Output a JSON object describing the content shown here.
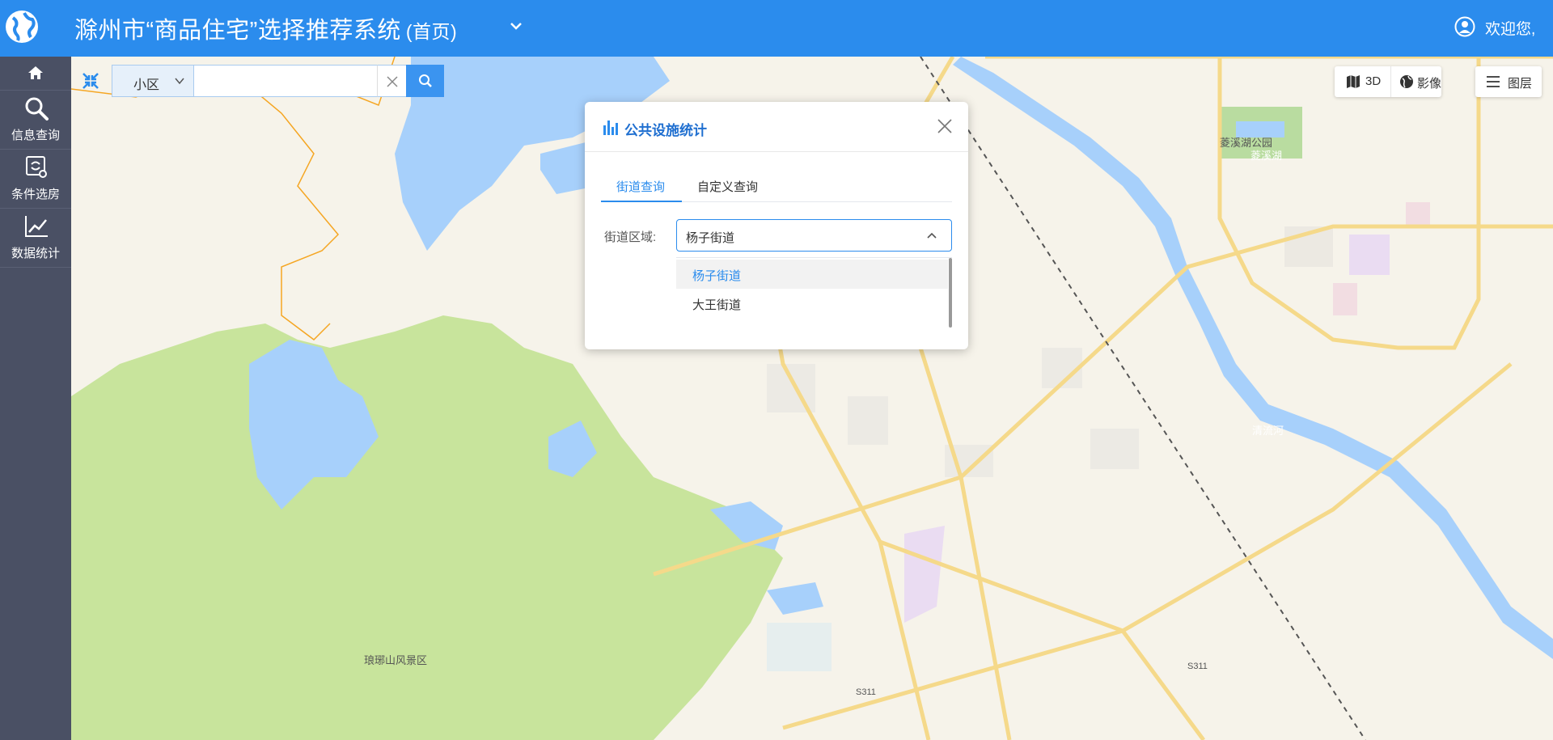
{
  "header": {
    "title": "滁州市“商品住宅”选择推荐系统",
    "subtitle": "(首页)",
    "welcome": "欢迎您,",
    "logo_icon": "globe-icon",
    "user_icon": "user-icon"
  },
  "sidebar": {
    "items": [
      {
        "label": "",
        "icon": "home-icon"
      },
      {
        "label": "信息查询",
        "icon": "search-icon"
      },
      {
        "label": "条件选房",
        "icon": "settings-icon"
      },
      {
        "label": "数据统计",
        "icon": "chart-icon"
      }
    ]
  },
  "search": {
    "type": "小区",
    "value": "",
    "placeholder": ""
  },
  "map_tools": {
    "btn_3d": "3D",
    "btn_imagery": "影像",
    "btn_layers": "图层"
  },
  "dialog": {
    "title": "公共设施统计",
    "tabs": [
      "街道查询",
      "自定义查询"
    ],
    "active_tab": "街道查询",
    "field_label": "街道区域:",
    "selected_value": "杨子街道",
    "options": [
      "杨子街道",
      "大王街道"
    ]
  },
  "map_labels": {
    "scenic_area": "琅琊山风景区",
    "park": "菱溪湖公园",
    "lake": "菱溪湖",
    "river": "清流河",
    "road1": "S311",
    "road2": "S311"
  },
  "colors": {
    "header_bg": "#2b8ced",
    "sidebar_bg": "#4a5064",
    "accent": "#2b8ced",
    "water": "#a7d0fb",
    "green": "#c8e49c",
    "road": "#f5d98a"
  }
}
